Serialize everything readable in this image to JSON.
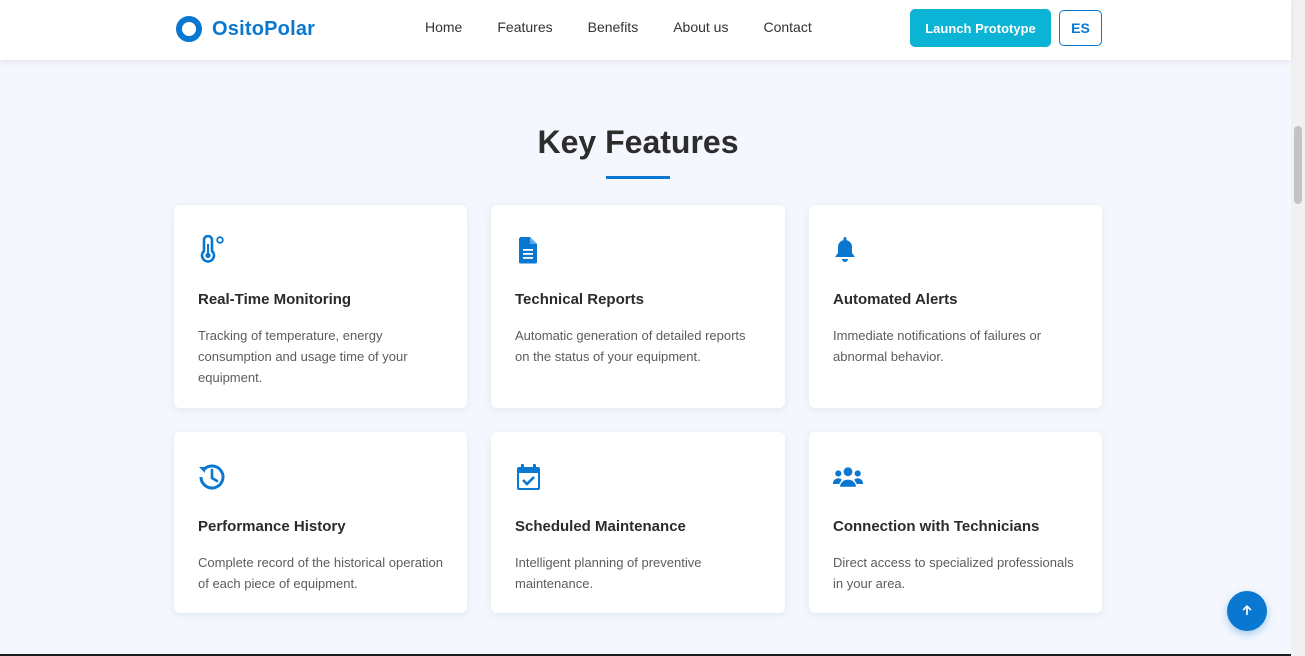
{
  "brand": {
    "name": "OsitoPolar",
    "icon": "circle-logo-icon"
  },
  "nav": {
    "links": [
      {
        "label": "Home"
      },
      {
        "label": "Features"
      },
      {
        "label": "Benefits"
      },
      {
        "label": "About us"
      },
      {
        "label": "Contact"
      }
    ],
    "launch_label": "Launch Prototype",
    "lang_label": "ES"
  },
  "section": {
    "title": "Key Features"
  },
  "features": [
    {
      "icon": "thermometer-icon",
      "title": "Real-Time Monitoring",
      "description": "Tracking of temperature, energy consumption and usage time of your equipment."
    },
    {
      "icon": "document-icon",
      "title": "Technical Reports",
      "description": "Automatic generation of detailed reports on the status of your equipment."
    },
    {
      "icon": "bell-icon",
      "title": "Automated Alerts",
      "description": "Immediate notifications of failures or abnormal behavior."
    },
    {
      "icon": "history-icon",
      "title": "Performance History",
      "description": "Complete record of the historical operation of each piece of equipment."
    },
    {
      "icon": "calendar-check-icon",
      "title": "Scheduled Maintenance",
      "description": "Intelligent planning of preventive maintenance."
    },
    {
      "icon": "users-icon",
      "title": "Connection with Technicians",
      "description": "Direct access to specialized professionals in your area."
    }
  ],
  "colors": {
    "primary": "#0a78d1",
    "accent": "#0bb4d4",
    "background": "#f4f7fd"
  },
  "back_to_top": {
    "icon": "arrow-up-icon"
  }
}
